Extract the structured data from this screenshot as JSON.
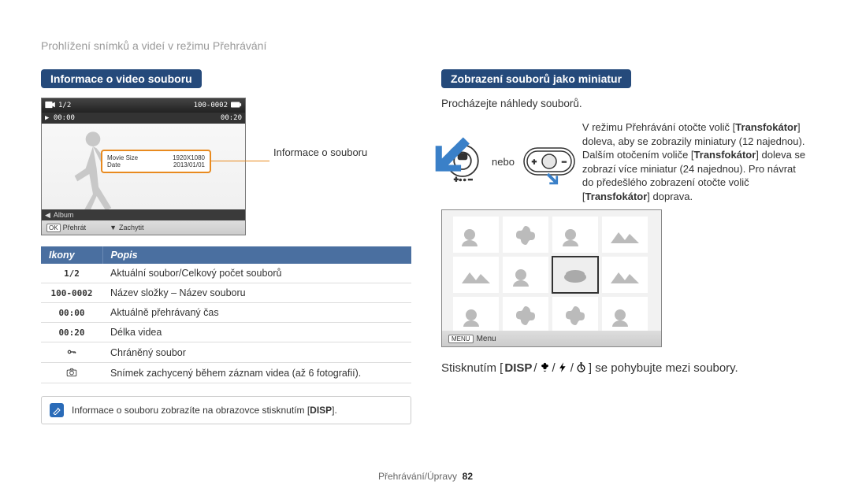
{
  "breadcrumb": "Prohlížení snímků a videí v režimu Přehrávání",
  "left": {
    "section_title": "Informace o video souboru",
    "callout": "Informace o souboru",
    "lcd": {
      "counter": "1/2",
      "file_no": "100-0002",
      "time_cur": "00:00",
      "time_total": "00:20",
      "info_r1k": "Movie Size",
      "info_r1v": "1920X1080",
      "info_r2k": "Date",
      "info_r2v": "2013/01/01",
      "album": "Album",
      "btn_ok": "OK",
      "btn_play": "Přehrát",
      "btn_capture": "Zachytit"
    },
    "table": {
      "h1": "Ikony",
      "h2": "Popis",
      "rows": [
        {
          "ico": "1/2",
          "txt": "Aktuální soubor/Celkový počet souborů"
        },
        {
          "ico": "100-0002",
          "txt": "Název složky – Název souboru"
        },
        {
          "ico": "00:00",
          "txt": "Aktuálně přehrávaný čas"
        },
        {
          "ico": "00:20",
          "txt": "Délka videa"
        },
        {
          "ico": "_KEY_",
          "txt": "Chráněný soubor"
        },
        {
          "ico": "_CAM_",
          "txt": "Snímek zachycený během záznam videa (až 6 fotografií)."
        }
      ]
    },
    "note_prefix": "Informace o souboru zobrazíte na obrazovce stisknutím [",
    "note_disp": "DISP",
    "note_suffix": "]."
  },
  "right": {
    "section_title": "Zobrazení souborů jako miniatur",
    "subtitle": "Procházejte náhledy souborů.",
    "nebo": "nebo",
    "instruction_1": "V režimu Přehrávání otočte volič [",
    "instruction_kw1": "Transfokátor",
    "instruction_2": "] doleva, aby se zobrazily miniatury (12 najednou). Dalším otočením voliče [",
    "instruction_kw2": "Transfokátor",
    "instruction_3": "] doleva se zobrazí více miniatur (24 najednou). Pro návrat do předešlého zobrazení otočte volič [",
    "instruction_kw3": "Transfokátor",
    "instruction_4": "] doprava.",
    "thumb_menu_btn": "MENU",
    "thumb_menu_lbl": "Menu",
    "nav_prefix": "Stisknutím [",
    "nav_disp": "DISP",
    "nav_suffix": "] se pohybujte mezi soubory."
  },
  "footer": {
    "path": "Přehrávání/Úpravy",
    "page": "82"
  }
}
